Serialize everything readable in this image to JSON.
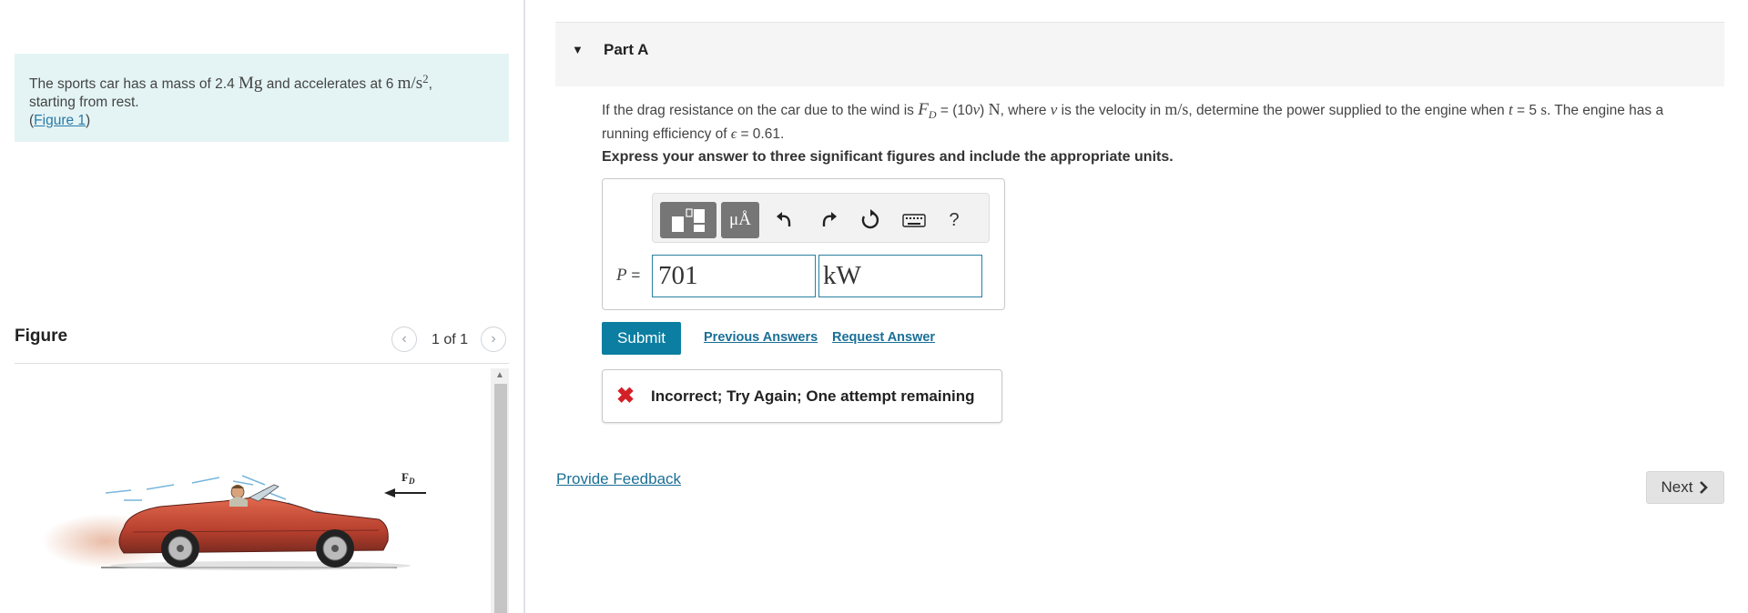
{
  "problem": {
    "text_1": "The sports car has a mass of 2.4",
    "mass_unit": "Mg",
    "text_2": "and accelerates at 6",
    "accel_unit": "m/s",
    "accel_exp": "2",
    "text_3": ",",
    "text_4": "starting from rest.",
    "figure_link": "Figure 1",
    "paren_open": "(",
    "paren_close": ")"
  },
  "figure": {
    "title": "Figure",
    "counter": "1 of 1",
    "force_label": "F",
    "force_sub": "D"
  },
  "part": {
    "title": "Part A",
    "question": {
      "q1": "If the drag resistance on the car due to the wind is",
      "fd": "F",
      "fd_sub": "D",
      "q2": "= (10",
      "v": "v",
      "q3": ")",
      "n_unit": "N",
      "q4": ", where",
      "v2": "v",
      "q5": "is the velocity in",
      "ms": "m/s",
      "q6": ", determine the power supplied to the engine when",
      "t": "t",
      "q7": "= 5",
      "s_unit": "s",
      "q8": ". The engine has a running efficiency of",
      "eps": "ϵ",
      "q9": "= 0.61."
    },
    "instructions": "Express your answer to three significant figures and include the appropriate units."
  },
  "answer": {
    "variable": "P",
    "equals": "=",
    "value": "701",
    "unit": "kW"
  },
  "toolbar": {
    "symbols_label": "μÅ",
    "help_label": "?"
  },
  "actions": {
    "submit": "Submit",
    "previous_answers": "Previous Answers",
    "request_answer": "Request Answer"
  },
  "feedback": {
    "icon": "✖",
    "message": "Incorrect; Try Again; One attempt remaining"
  },
  "footer": {
    "provide_feedback": "Provide Feedback",
    "next": "Next"
  }
}
